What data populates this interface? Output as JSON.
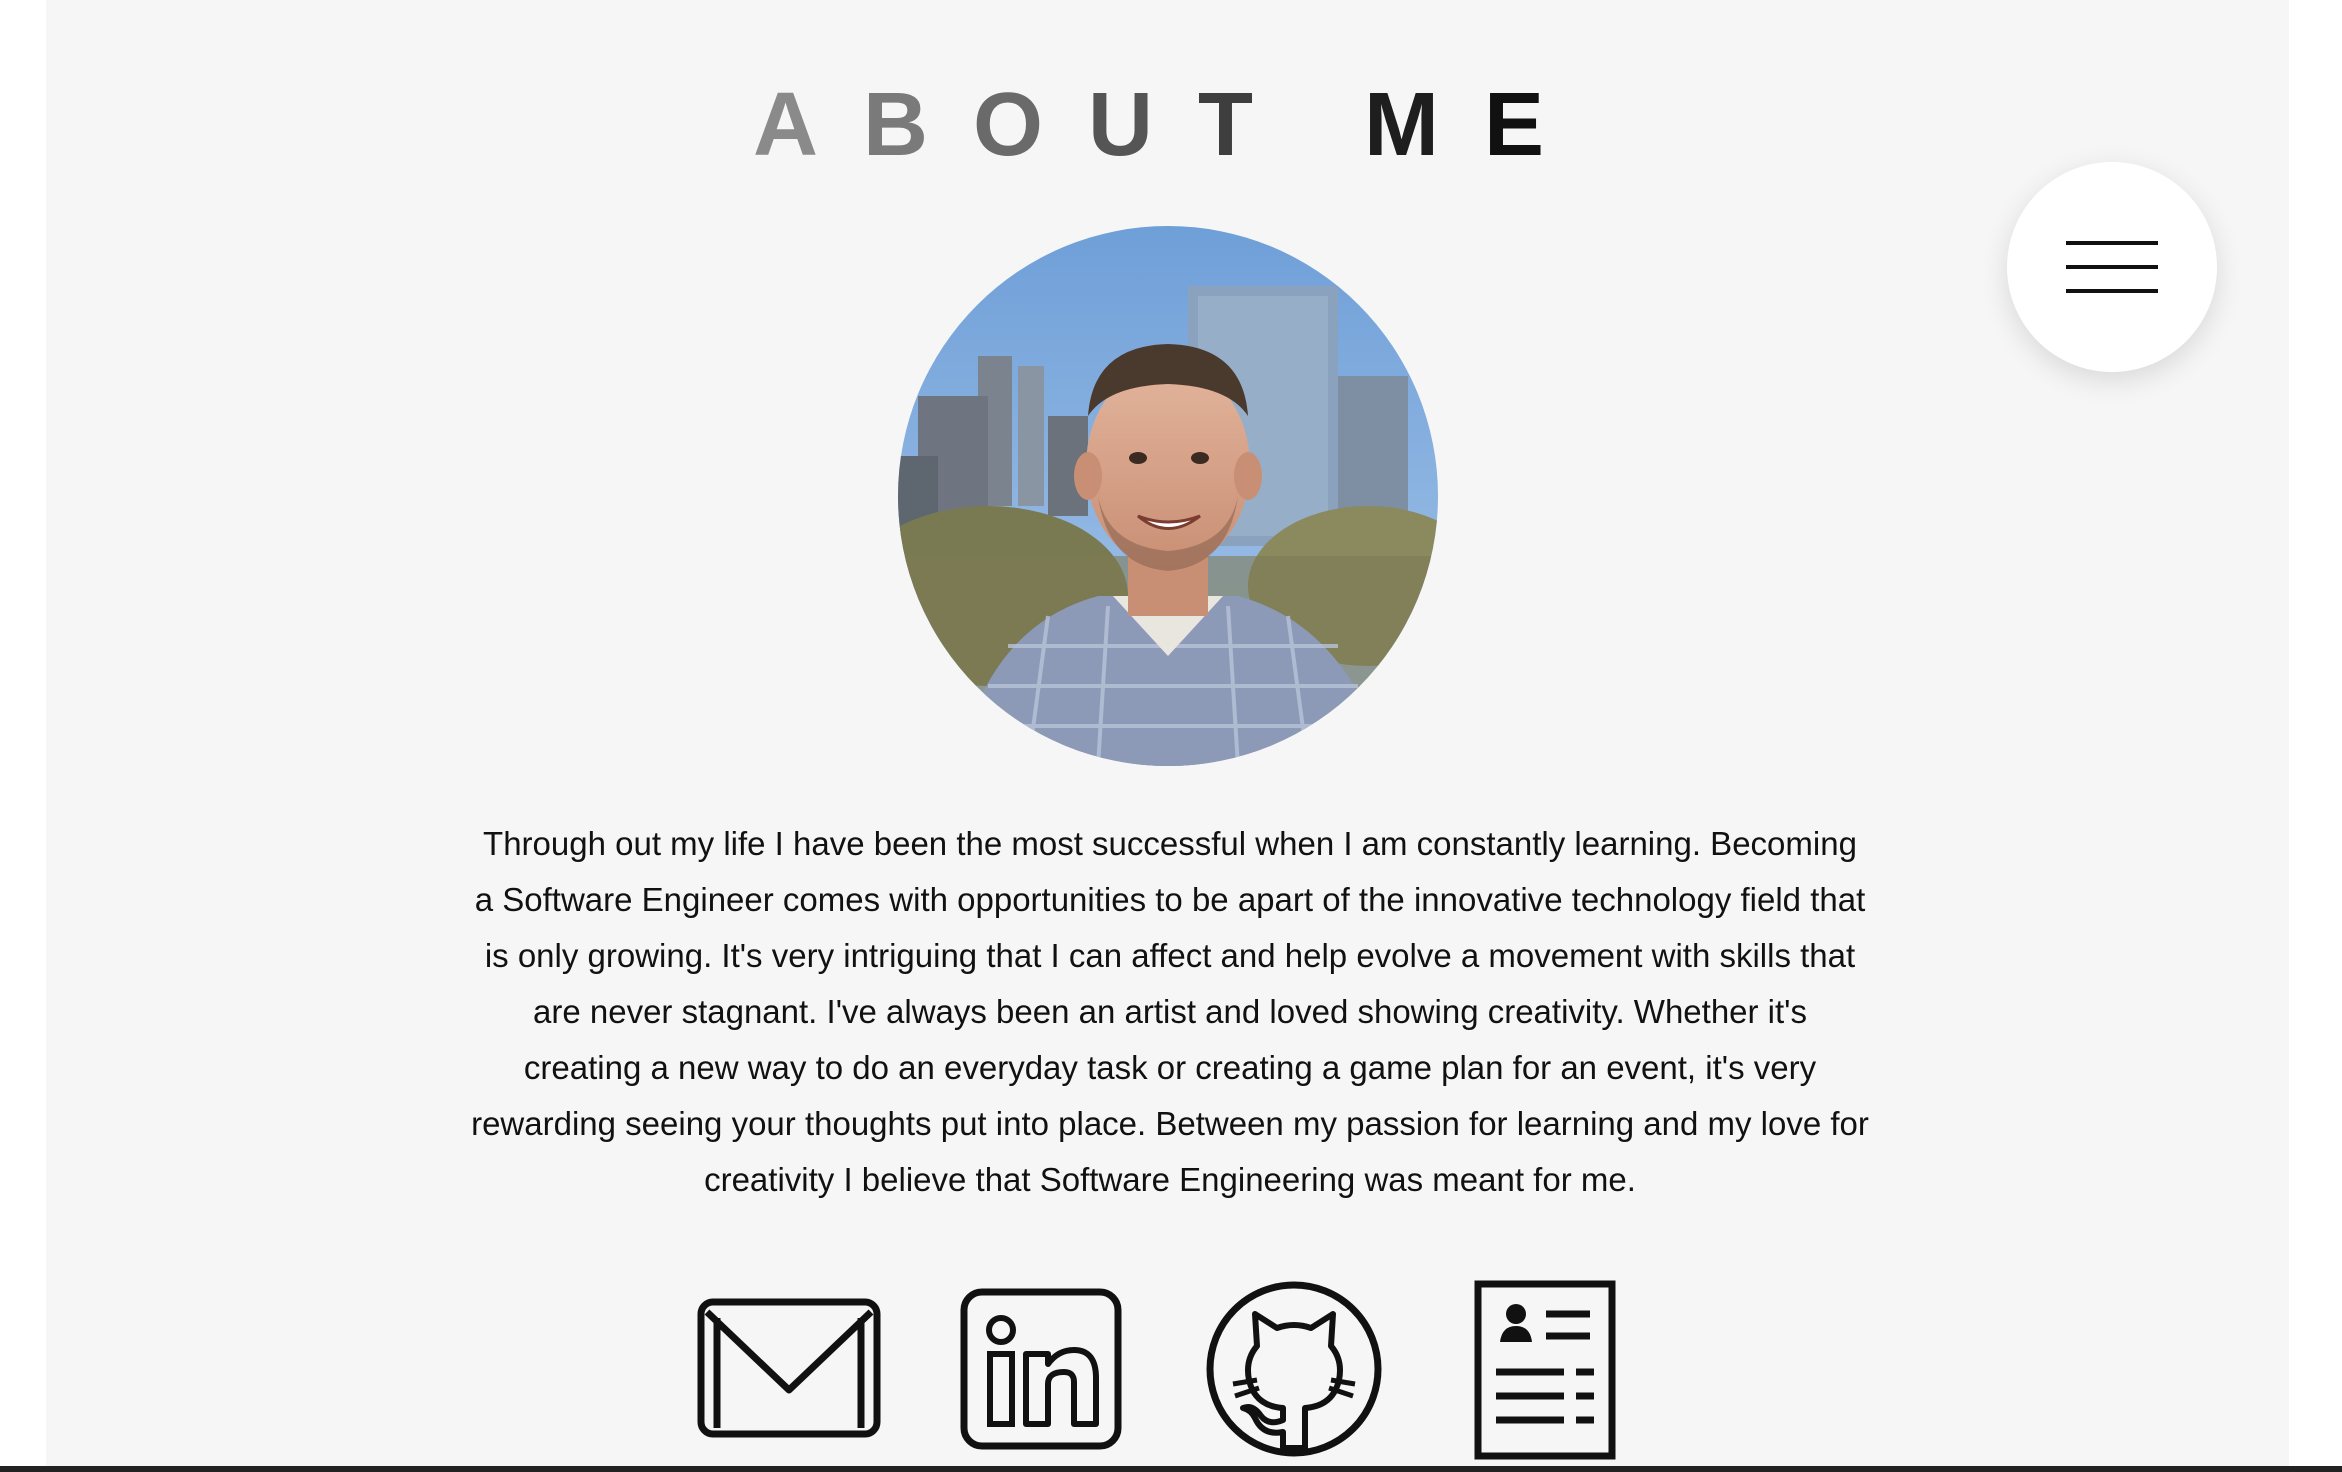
{
  "header": {
    "title_letters": [
      {
        "char": "A",
        "color": "#8a8a8a"
      },
      {
        "char": "B",
        "color": "#7a7a7a"
      },
      {
        "char": "O",
        "color": "#6a6a6a"
      },
      {
        "char": "U",
        "color": "#555555"
      },
      {
        "char": "T",
        "color": "#3e3e3e"
      },
      {
        "char": "M",
        "color": "#1e1e1e"
      },
      {
        "char": "E",
        "color": "#111111"
      }
    ]
  },
  "menu": {
    "icon": "hamburger-menu-icon"
  },
  "profile": {
    "photo": "profile-photo"
  },
  "bio": {
    "text": "Through out my life I have been the most successful when I am constantly learning. Becoming a Software Engineer comes with opportunities to be apart of the innovative technology field that is only growing. It's very intriguing that I can affect and help evolve a movement with skills that are never stagnant. I've always been an artist and loved showing creativity. Whether it's creating a new way to do an everyday task or creating a game plan for an event, it's very rewarding seeing your thoughts put into place. Between my passion for learning and my love for creativity I believe that Software Engineering was meant for me."
  },
  "social_links": [
    {
      "name": "email",
      "icon": "envelope-icon"
    },
    {
      "name": "linkedin",
      "icon": "linkedin-icon"
    },
    {
      "name": "github",
      "icon": "github-icon"
    },
    {
      "name": "resume",
      "icon": "resume-document-icon"
    }
  ],
  "colors": {
    "page_background": "#f6f6f6",
    "text": "#111111",
    "menu_button": "#ffffff"
  }
}
